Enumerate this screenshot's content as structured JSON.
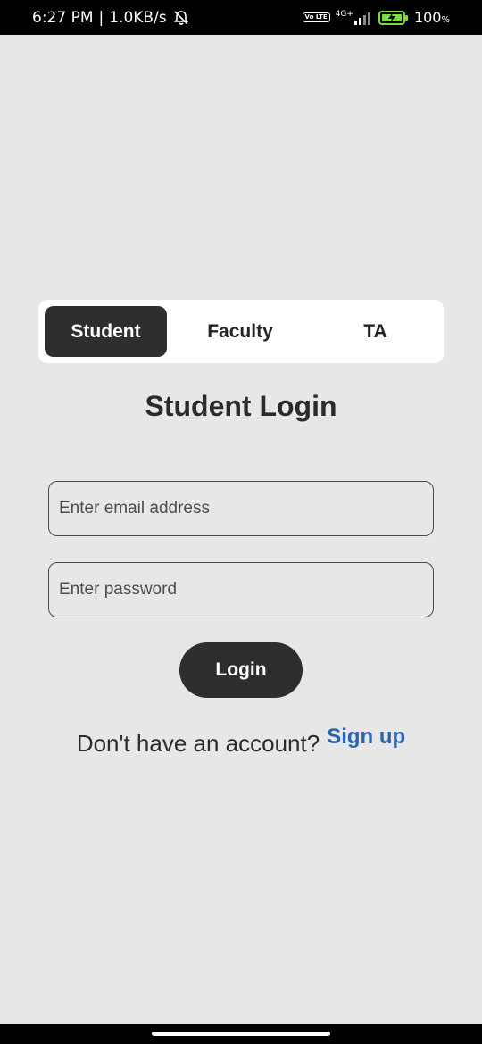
{
  "status_bar": {
    "time": "6:27 PM",
    "separator": "|",
    "net_speed": "1.0KB/s",
    "network": "4G+",
    "volte": "Vo LTE",
    "battery_percent": "100",
    "battery_unit": "%",
    "icons": [
      "mute-bell-icon",
      "volte-icon",
      "signal-icon",
      "battery-charging-icon"
    ]
  },
  "tabs": [
    {
      "label": "Student",
      "active": true
    },
    {
      "label": "Faculty",
      "active": false
    },
    {
      "label": "TA",
      "active": false
    }
  ],
  "login": {
    "title": "Student Login",
    "email_placeholder": "Enter email address",
    "password_placeholder": "Enter password",
    "button_label": "Login"
  },
  "signup": {
    "prompt": "Don't have an account?",
    "link": "Sign up"
  },
  "colors": {
    "background": "#e7e7e7",
    "dark": "#2e2e2e",
    "link": "#2a66b0"
  }
}
